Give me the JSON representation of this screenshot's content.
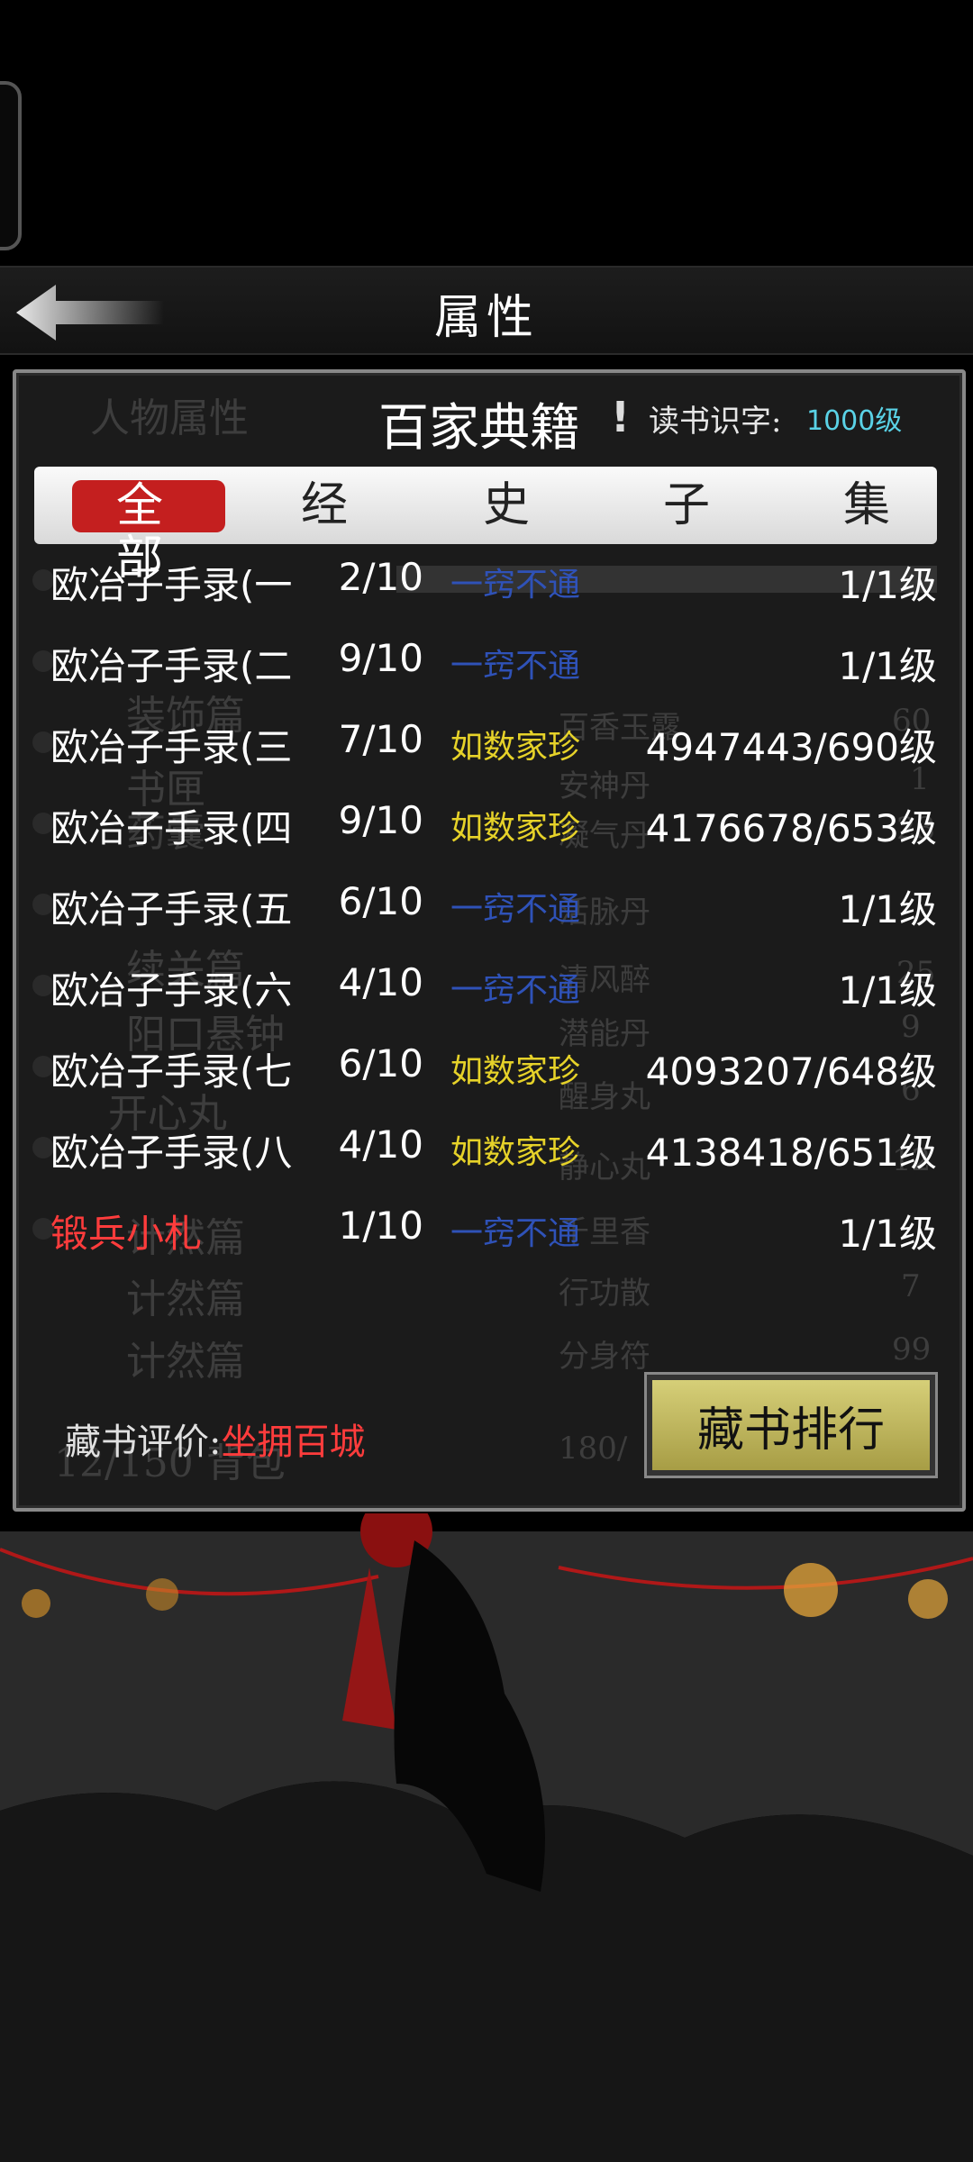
{
  "header": {
    "title": "属性"
  },
  "background_labels": [
    "人物属性",
    "装饰篇",
    "书匣",
    "药囊",
    "续关篇",
    "阳口悬钟",
    "开心丸",
    "计然篇",
    "计然篇",
    "计然篇",
    "12/150 背包",
    "百香玉露",
    "安神丹",
    "凝气丹",
    "活脉丹",
    "清风醉",
    "潜能丹",
    "醒身丸",
    "静心丸",
    "千里香",
    "行功散",
    "分身符",
    "60",
    "1",
    "23",
    "25",
    "9",
    "6",
    "12",
    "7",
    "99",
    "180/"
  ],
  "panel": {
    "title": "百家典籍",
    "bang": "!",
    "read_label": "读书识字:",
    "read_level": "1000级"
  },
  "tabs": [
    {
      "label": "全部",
      "active": true
    },
    {
      "label": "经"
    },
    {
      "label": "史"
    },
    {
      "label": "子"
    },
    {
      "label": "集"
    }
  ],
  "books": [
    {
      "name": "欧冶子手录(一",
      "count": "2/10",
      "status": "一窍不通",
      "status_color": "#2f52b8",
      "level": "1/1级"
    },
    {
      "name": "欧冶子手录(二",
      "count": "9/10",
      "status": "一窍不通",
      "status_color": "#2f52b8",
      "level": "1/1级"
    },
    {
      "name": "欧冶子手录(三",
      "count": "7/10",
      "status": "如数家珍",
      "status_color": "#e6d229",
      "level": "4947443/690级"
    },
    {
      "name": "欧冶子手录(四",
      "count": "9/10",
      "status": "如数家珍",
      "status_color": "#e6d229",
      "level": "4176678/653级"
    },
    {
      "name": "欧冶子手录(五",
      "count": "6/10",
      "status": "一窍不通",
      "status_color": "#2f52b8",
      "level": "1/1级"
    },
    {
      "name": "欧冶子手录(六",
      "count": "4/10",
      "status": "一窍不通",
      "status_color": "#2f52b8",
      "level": "1/1级"
    },
    {
      "name": "欧冶子手录(七",
      "count": "6/10",
      "status": "如数家珍",
      "status_color": "#e6d229",
      "level": "4093207/648级"
    },
    {
      "name": "欧冶子手录(八",
      "count": "4/10",
      "status": "如数家珍",
      "status_color": "#e6d229",
      "level": "4138418/651级"
    },
    {
      "name": "锻兵小札",
      "count": "1/10",
      "status": "一窍不通",
      "status_color": "#2f52b8",
      "level": "1/1级",
      "name_color": "#ff3c3c"
    }
  ],
  "footer": {
    "eval_label": "藏书评价:",
    "eval_value": "坐拥百城",
    "rank_button": "藏书排行"
  }
}
